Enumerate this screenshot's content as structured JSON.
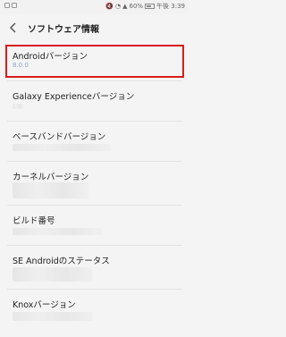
{
  "status": {
    "battery": "60%",
    "time": "午後 3:39"
  },
  "header": {
    "title": "ソフトウェア情報"
  },
  "items": [
    {
      "label": "Androidバージョン",
      "value": "8.0.0"
    },
    {
      "label": "Galaxy Experienceバージョン",
      "value": ""
    },
    {
      "label": "ベースバンドバージョン",
      "value": ""
    },
    {
      "label": "カーネルバージョン",
      "value": ""
    },
    {
      "label": "ビルド番号",
      "value": ""
    },
    {
      "label": "SE Androidのステータス",
      "value": ""
    },
    {
      "label": "Knoxバージョン",
      "value": ""
    }
  ],
  "colors": {
    "highlight": "#d91c1c",
    "value_text": "#8a9fc2"
  }
}
